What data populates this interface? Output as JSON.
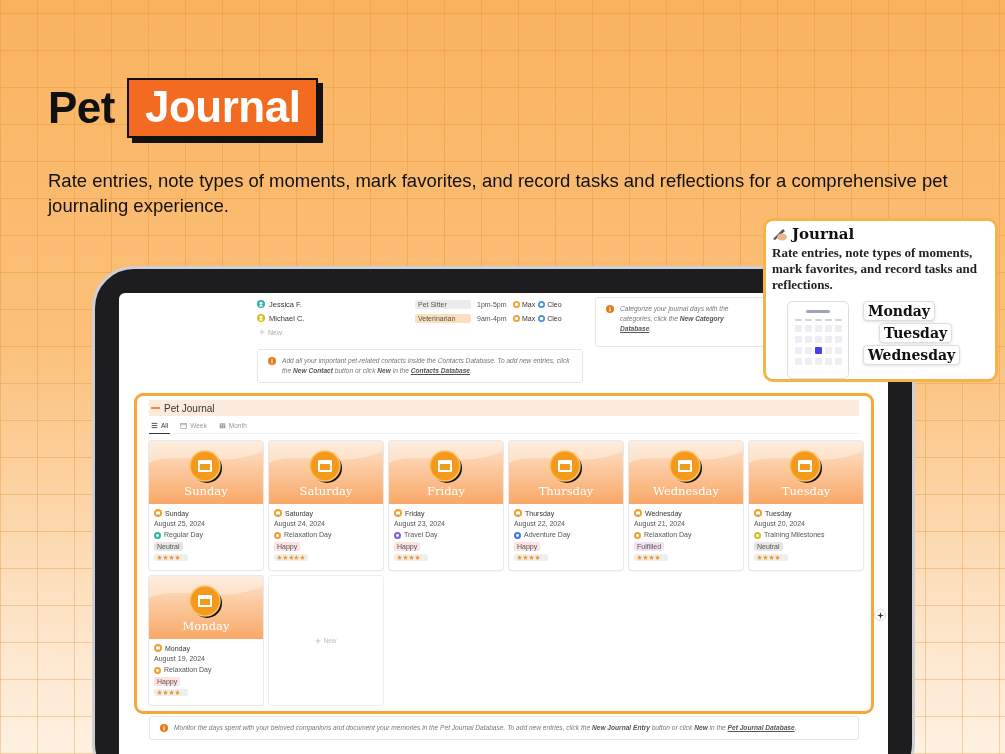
{
  "hero": {
    "title": "Pet",
    "title_highlight": "Journal",
    "subtitle": "Rate entries, note types of moments, mark favorites, and record tasks and reflections for a comprehensive pet journaling experience."
  },
  "contacts": {
    "rows": [
      {
        "name": "Jessica F.",
        "color": "#2bb3a6",
        "role": {
          "label": "Pet Sitter",
          "color": "#ececec"
        },
        "hours": "1pm-5pm",
        "pets": [
          {
            "name": "Max",
            "color": "#f0a030"
          },
          {
            "name": "Cleo",
            "color": "#4a8fe0"
          }
        ]
      },
      {
        "name": "Michael C.",
        "color": "#d6c21a",
        "role": {
          "label": "Veterinarian",
          "color": "#fbe0bd"
        },
        "hours": "9am-4pm",
        "pets": [
          {
            "name": "Max",
            "color": "#f0a030"
          },
          {
            "name": "Cleo",
            "color": "#4a8fe0"
          }
        ]
      }
    ],
    "new_label": "New",
    "note": {
      "text": "Add all your important pet-related contacts inside the Contacts Database. To add new entries, click the **New Contact** button or click **New** in the",
      "link": "Contacts Database",
      "suffix": "."
    }
  },
  "categories_note": {
    "lines": [
      "Categorize your journal days with the",
      "categories, click the **New Category**"
    ],
    "link": "Database",
    "suffix": "."
  },
  "journal": {
    "title": "Pet Journal",
    "tabs": [
      {
        "label": "All",
        "selected": true
      },
      {
        "label": "Week",
        "selected": false
      },
      {
        "label": "Month",
        "selected": false
      }
    ],
    "entries": [
      {
        "cover_label": "Sunday",
        "name": "Sunday",
        "date": "August 25, 2024",
        "type": {
          "label": "Regular Day",
          "color": "#2bb3a6"
        },
        "mood": {
          "label": "Neutral",
          "color": "#e6e6e4"
        },
        "stars": 4
      },
      {
        "cover_label": "Saturday",
        "name": "Saturday",
        "date": "August 24, 2024",
        "type": {
          "label": "Relaxation Day",
          "color": "#f0a030"
        },
        "mood": {
          "label": "Happy",
          "color": "#fde2e1"
        },
        "stars": 5
      },
      {
        "cover_label": "Friday",
        "name": "Friday",
        "date": "August 23, 2024",
        "type": {
          "label": "Travel Day",
          "color": "#7b5fe0"
        },
        "mood": {
          "label": "Happy",
          "color": "#fde2e1"
        },
        "stars": 4
      },
      {
        "cover_label": "Thursday",
        "name": "Thursday",
        "date": "August 22, 2024",
        "type": {
          "label": "Adventure Day",
          "color": "#3d7be0"
        },
        "mood": {
          "label": "Happy",
          "color": "#fde2e1"
        },
        "stars": 4
      },
      {
        "cover_label": "Wednesday",
        "name": "Wednesday",
        "date": "August 21, 2024",
        "type": {
          "label": "Relaxation Day",
          "color": "#f0a030"
        },
        "mood": {
          "label": "Fulfilled",
          "color": "#f6e1f1"
        },
        "stars": 4
      },
      {
        "cover_label": "Tuesday",
        "name": "Tuesday",
        "date": "August 20, 2024",
        "type": {
          "label": "Training Milestones",
          "color": "#cfc224"
        },
        "mood": {
          "label": "Neutral",
          "color": "#e6e6e4"
        },
        "stars": 4
      },
      {
        "cover_label": "Monday",
        "name": "Monday",
        "date": "August 19, 2024",
        "type": {
          "label": "Relaxation Day",
          "color": "#f0a030"
        },
        "mood": {
          "label": "Happy",
          "color": "#fde2e1"
        },
        "stars": 4
      }
    ],
    "new_label": "New",
    "note": {
      "text": "Monitor the days spent with your beloved companions and document your memories in the Pet Journal Database. To add new entries, click the **New Journal Entry** button or click **New** in the",
      "link": "Pet Journal Database",
      "suffix": "."
    }
  },
  "callout": {
    "title": "Journal",
    "text": "Rate entries, note types of moments, mark favorites, and record tasks and reflections.",
    "days": [
      "Monday",
      "Tuesday",
      "Wednesday"
    ]
  }
}
